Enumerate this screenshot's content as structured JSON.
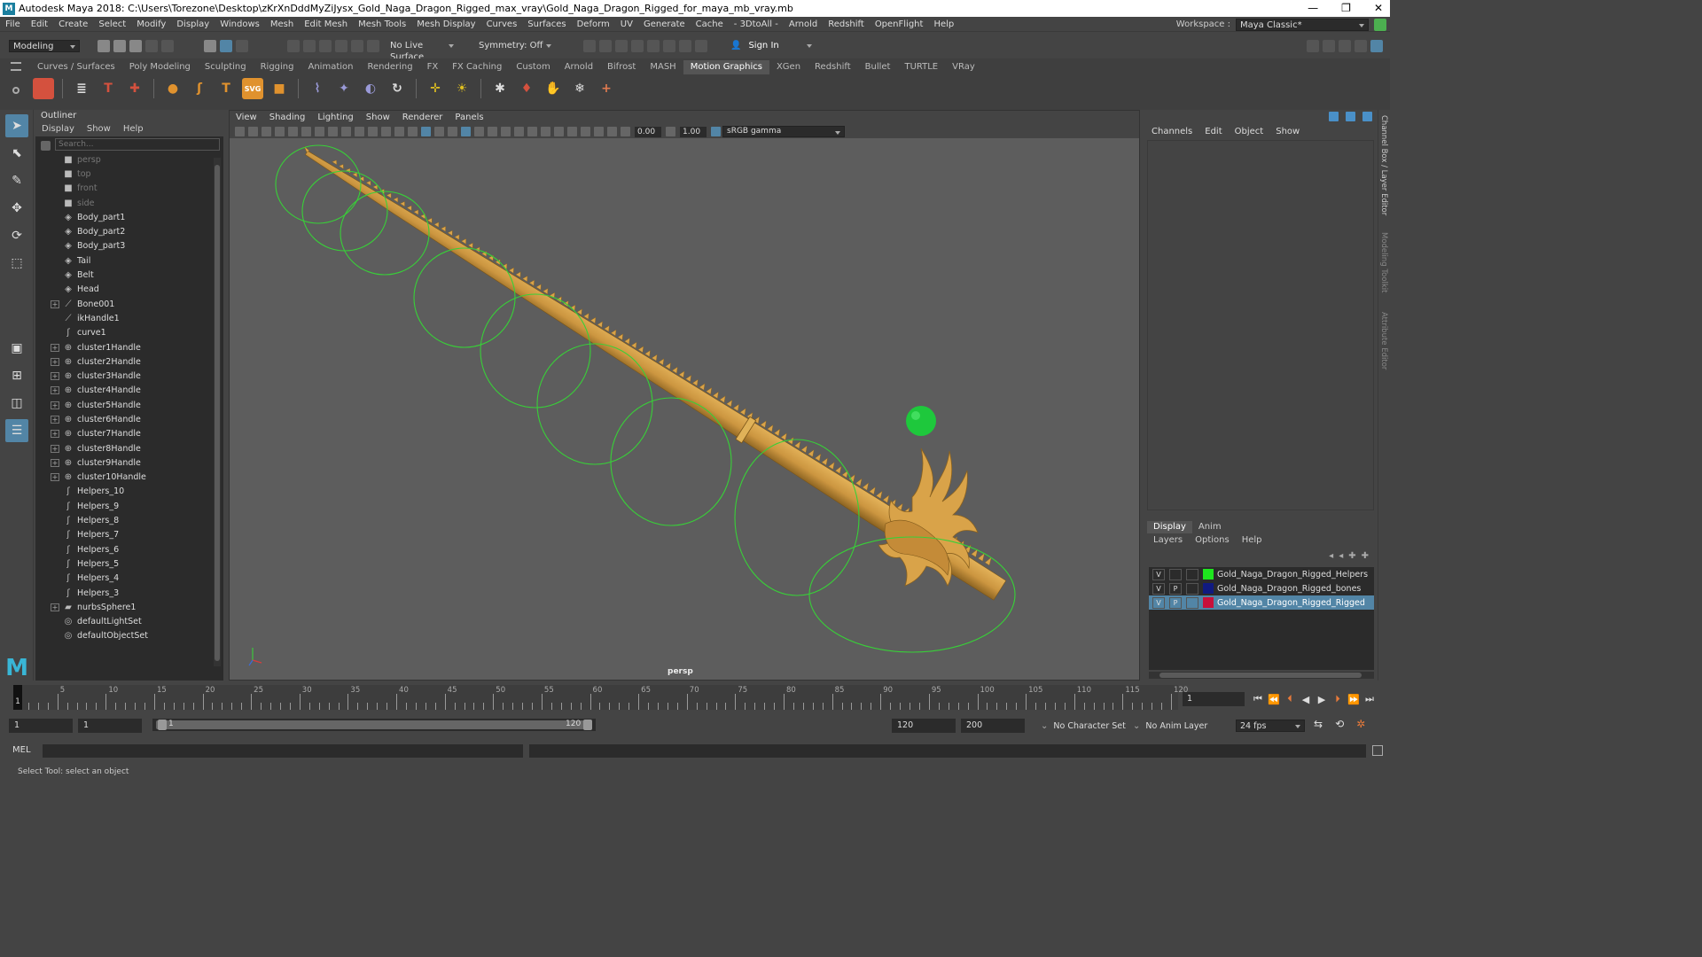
{
  "title_bar": {
    "text": "Autodesk Maya 2018: C:\\Users\\Torezone\\Desktop\\zKrXnDddMyZiJysx_Gold_Naga_Dragon_Rigged_max_vray\\Gold_Naga_Dragon_Rigged_for_maya_mb_vray.mb",
    "minimize": "—",
    "restore": "❐",
    "close": "✕"
  },
  "menu": [
    "File",
    "Edit",
    "Create",
    "Select",
    "Modify",
    "Display",
    "Windows",
    "Mesh",
    "Edit Mesh",
    "Mesh Tools",
    "Mesh Display",
    "Curves",
    "Surfaces",
    "Deform",
    "UV",
    "Generate",
    "Cache",
    "- 3DtoAll -",
    "Arnold",
    "Redshift",
    "OpenFlight",
    "Help"
  ],
  "workspace": {
    "label": "Workspace :",
    "value": "Maya Classic*"
  },
  "status_line": {
    "mode": "Modeling",
    "live_surface": "No Live Surface",
    "symmetry": "Symmetry: Off",
    "sign_in": "Sign In"
  },
  "shelf_tabs": [
    "Curves / Surfaces",
    "Poly Modeling",
    "Sculpting",
    "Rigging",
    "Animation",
    "Rendering",
    "FX",
    "FX Caching",
    "Custom",
    "Arnold",
    "Bifrost",
    "MASH",
    "Motion Graphics",
    "XGen",
    "Redshift",
    "Bullet",
    "TURTLE",
    "VRay"
  ],
  "shelf_active": "Motion Graphics",
  "shelf_icons": [
    {
      "label": "",
      "color": "#d4513e",
      "icon": "cube-icon"
    },
    {
      "label": "≣",
      "color": "#dddddd",
      "icon": "list-icon"
    },
    {
      "label": "T",
      "color": "#d4513e",
      "icon": "text-icon"
    },
    {
      "label": "✚",
      "color": "#d4513e",
      "icon": "paint-icon"
    },
    {
      "label": "●",
      "color": "#e0922e",
      "icon": "sphere-icon"
    },
    {
      "label": "ʃ",
      "color": "#e0922e",
      "icon": "curve-icon"
    },
    {
      "label": "T",
      "color": "#e0922e",
      "icon": "type-icon"
    },
    {
      "label": "SVG",
      "color": "#e0922e",
      "icon": "svg-icon"
    },
    {
      "label": "■",
      "color": "#e0922e",
      "icon": "box-icon"
    },
    {
      "label": "⌇",
      "color": "#9a9ad8",
      "icon": "hair-icon"
    },
    {
      "label": "✦",
      "color": "#9a9ad8",
      "icon": "burst-icon"
    },
    {
      "label": "◐",
      "color": "#9a9ad8",
      "icon": "shell-icon"
    },
    {
      "label": "↻",
      "color": "#dddddd",
      "icon": "rotate-icon"
    },
    {
      "label": "✛",
      "color": "#e0c020",
      "icon": "move-axis-icon"
    },
    {
      "label": "☀",
      "color": "#e0c020",
      "icon": "light-icon"
    },
    {
      "label": "✱",
      "color": "#dddddd",
      "icon": "particle-icon"
    },
    {
      "label": "♦",
      "color": "#d4513e",
      "icon": "shirt-icon"
    },
    {
      "label": "✋",
      "color": "#e07a50",
      "icon": "hand-icon"
    },
    {
      "label": "❄",
      "color": "#dddddd",
      "icon": "snow-icon"
    },
    {
      "label": "+",
      "color": "#e07a50",
      "icon": "plus-icon"
    }
  ],
  "outliner": {
    "title": "Outliner",
    "menu": [
      "Display",
      "Show",
      "Help"
    ],
    "search_placeholder": "Search...",
    "items": [
      {
        "label": "persp",
        "icon": "camera-icon",
        "glyph": "■",
        "expand": false,
        "dim": true
      },
      {
        "label": "top",
        "icon": "camera-icon",
        "glyph": "■",
        "expand": false,
        "dim": true
      },
      {
        "label": "front",
        "icon": "camera-icon",
        "glyph": "■",
        "expand": false,
        "dim": true
      },
      {
        "label": "side",
        "icon": "camera-icon",
        "glyph": "■",
        "expand": false,
        "dim": true
      },
      {
        "label": "Body_part1",
        "icon": "mesh-icon",
        "glyph": "◈",
        "expand": false,
        "dim": false
      },
      {
        "label": "Body_part2",
        "icon": "mesh-icon",
        "glyph": "◈",
        "expand": false,
        "dim": false
      },
      {
        "label": "Body_part3",
        "icon": "mesh-icon",
        "glyph": "◈",
        "expand": false,
        "dim": false
      },
      {
        "label": "Tail",
        "icon": "mesh-icon",
        "glyph": "◈",
        "expand": false,
        "dim": false
      },
      {
        "label": "Belt",
        "icon": "mesh-icon",
        "glyph": "◈",
        "expand": false,
        "dim": false
      },
      {
        "label": "Head",
        "icon": "mesh-icon",
        "glyph": "◈",
        "expand": false,
        "dim": false
      },
      {
        "label": "Bone001",
        "icon": "joint-icon",
        "glyph": "⟋",
        "expand": true,
        "dim": false
      },
      {
        "label": "ikHandle1",
        "icon": "ik-handle-icon",
        "glyph": "⟋",
        "expand": false,
        "dim": false
      },
      {
        "label": "curve1",
        "icon": "curve-icon",
        "glyph": "ʃ",
        "expand": false,
        "dim": false
      },
      {
        "label": "cluster1Handle",
        "icon": "cluster-icon",
        "glyph": "⊕",
        "expand": true,
        "dim": false
      },
      {
        "label": "cluster2Handle",
        "icon": "cluster-icon",
        "glyph": "⊕",
        "expand": true,
        "dim": false
      },
      {
        "label": "cluster3Handle",
        "icon": "cluster-icon",
        "glyph": "⊕",
        "expand": true,
        "dim": false
      },
      {
        "label": "cluster4Handle",
        "icon": "cluster-icon",
        "glyph": "⊕",
        "expand": true,
        "dim": false
      },
      {
        "label": "cluster5Handle",
        "icon": "cluster-icon",
        "glyph": "⊕",
        "expand": true,
        "dim": false
      },
      {
        "label": "cluster6Handle",
        "icon": "cluster-icon",
        "glyph": "⊕",
        "expand": true,
        "dim": false
      },
      {
        "label": "cluster7Handle",
        "icon": "cluster-icon",
        "glyph": "⊕",
        "expand": true,
        "dim": false
      },
      {
        "label": "cluster8Handle",
        "icon": "cluster-icon",
        "glyph": "⊕",
        "expand": true,
        "dim": false
      },
      {
        "label": "cluster9Handle",
        "icon": "cluster-icon",
        "glyph": "⊕",
        "expand": true,
        "dim": false
      },
      {
        "label": "cluster10Handle",
        "icon": "cluster-icon",
        "glyph": "⊕",
        "expand": true,
        "dim": false
      },
      {
        "label": "Helpers_10",
        "icon": "curve-icon",
        "glyph": "ʃ",
        "expand": false,
        "dim": false
      },
      {
        "label": "Helpers_9",
        "icon": "curve-icon",
        "glyph": "ʃ",
        "expand": false,
        "dim": false
      },
      {
        "label": "Helpers_8",
        "icon": "curve-icon",
        "glyph": "ʃ",
        "expand": false,
        "dim": false
      },
      {
        "label": "Helpers_7",
        "icon": "curve-icon",
        "glyph": "ʃ",
        "expand": false,
        "dim": false
      },
      {
        "label": "Helpers_6",
        "icon": "curve-icon",
        "glyph": "ʃ",
        "expand": false,
        "dim": false
      },
      {
        "label": "Helpers_5",
        "icon": "curve-icon",
        "glyph": "ʃ",
        "expand": false,
        "dim": false
      },
      {
        "label": "Helpers_4",
        "icon": "curve-icon",
        "glyph": "ʃ",
        "expand": false,
        "dim": false
      },
      {
        "label": "Helpers_3",
        "icon": "curve-icon",
        "glyph": "ʃ",
        "expand": false,
        "dim": false
      },
      {
        "label": "nurbsSphere1",
        "icon": "nurbs-icon",
        "glyph": "▰",
        "expand": true,
        "dim": false
      },
      {
        "label": "defaultLightSet",
        "icon": "set-icon",
        "glyph": "◎",
        "expand": false,
        "dim": false
      },
      {
        "label": "defaultObjectSet",
        "icon": "set-icon",
        "glyph": "◎",
        "expand": false,
        "dim": false
      }
    ]
  },
  "viewport": {
    "menu": [
      "View",
      "Shading",
      "Lighting",
      "Show",
      "Renderer",
      "Panels"
    ],
    "exposure": "0.00",
    "gamma": "1.00",
    "color_space": "sRGB gamma",
    "camera_label": "persp",
    "colors": {
      "background": "#5d5d5d",
      "dragon": "#d9a349",
      "rig_circles": "#38d038",
      "sphere": "#1ec83c"
    }
  },
  "channel_box": {
    "menu": [
      "Channels",
      "Edit",
      "Object",
      "Show"
    ]
  },
  "side_tabs": [
    "Channel Box / Layer Editor",
    "Modeling Toolkit",
    "Attribute Editor"
  ],
  "layer_editor": {
    "tabs": [
      "Display",
      "Anim"
    ],
    "active_tab": "Display",
    "menu": [
      "Layers",
      "Options",
      "Help"
    ],
    "layers": [
      {
        "v": "V",
        "p": "",
        "name": "Gold_Naga_Dragon_Rigged_Helpers",
        "color": "#1ee61e",
        "selected": false
      },
      {
        "v": "V",
        "p": "P",
        "name": "Gold_Naga_Dragon_Rigged_bones",
        "color": "#101a80",
        "selected": false
      },
      {
        "v": "V",
        "p": "P",
        "name": "Gold_Naga_Dragon_Rigged_Rigged",
        "color": "#c8103a",
        "selected": true
      }
    ]
  },
  "timeline": {
    "tick_labels": [
      "5",
      "10",
      "15",
      "20",
      "25",
      "30",
      "35",
      "40",
      "45",
      "50",
      "55",
      "60",
      "65",
      "70",
      "75",
      "80",
      "85",
      "90",
      "95",
      "100",
      "105",
      "110",
      "115",
      "120"
    ],
    "range_start": 1,
    "range_end": 120,
    "current_frame": "1",
    "frame_field": "1"
  },
  "range_slider": {
    "start_time": "1",
    "playback_start": "1",
    "slider_start": "1",
    "slider_end": "120",
    "playback_end": "120",
    "end_time": "200",
    "character_set": "No Character Set",
    "anim_layer": "No Anim Layer",
    "fps": "24 fps"
  },
  "command_line": {
    "label": "MEL"
  },
  "help_line": "Select Tool: select an object"
}
